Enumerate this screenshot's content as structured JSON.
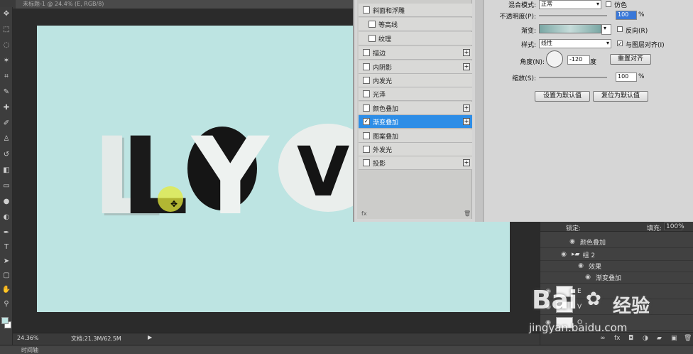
{
  "document_tab": {
    "title": "未标题-1 @ 24.4% (E, RGB/8)"
  },
  "toolbar": {
    "icons": [
      "move-icon",
      "marquee-icon",
      "lasso-icon",
      "magic-wand-icon",
      "crop-icon",
      "eyedropper-icon",
      "heal-icon",
      "brush-icon",
      "stamp-icon",
      "history-brush-icon",
      "eraser-icon",
      "gradient-icon",
      "blur-icon",
      "dodge-icon",
      "pen-icon",
      "type-icon",
      "path-select-icon",
      "shape-icon",
      "hand-icon",
      "zoom-icon"
    ]
  },
  "canvas": {
    "background": "#bde4e2",
    "letters": [
      "L",
      "Y",
      "O",
      "V"
    ]
  },
  "statusbar": {
    "zoom": "24.36%",
    "doc_size": "文档:21.3M/62.5M"
  },
  "timeline": {
    "label": "时间轴"
  },
  "layer_style": {
    "items": [
      {
        "label": "斜面和浮雕",
        "checked": false,
        "sub": false,
        "plus": false
      },
      {
        "label": "等高线",
        "checked": false,
        "sub": true,
        "plus": false
      },
      {
        "label": "纹理",
        "checked": false,
        "sub": true,
        "plus": false
      },
      {
        "label": "描边",
        "checked": false,
        "sub": false,
        "plus": true
      },
      {
        "label": "内阴影",
        "checked": false,
        "sub": false,
        "plus": true
      },
      {
        "label": "内发光",
        "checked": false,
        "sub": false,
        "plus": false
      },
      {
        "label": "光泽",
        "checked": false,
        "sub": false,
        "plus": false
      },
      {
        "label": "颜色叠加",
        "checked": false,
        "sub": false,
        "plus": true
      },
      {
        "label": "渐变叠加",
        "checked": true,
        "sub": false,
        "plus": true,
        "selected": true
      },
      {
        "label": "图案叠加",
        "checked": false,
        "sub": false,
        "plus": false
      },
      {
        "label": "外发光",
        "checked": false,
        "sub": false,
        "plus": false
      },
      {
        "label": "投影",
        "checked": false,
        "sub": false,
        "plus": true
      }
    ],
    "options": {
      "blend_mode_label": "混合模式:",
      "blend_mode_value": "正常",
      "dither_label": "仿色",
      "opacity_label": "不透明度(P):",
      "opacity_value": "100",
      "percent": "%",
      "gradient_label": "渐变:",
      "reverse_label": "反向(R)",
      "style_label": "样式:",
      "style_value": "线性",
      "align_label": "与图层对齐(I)",
      "angle_label": "角度(N):",
      "angle_value": "-120",
      "degree": "度",
      "reset_align": "重置对齐",
      "scale_label": "缩放(S):",
      "scale_value": "100",
      "set_default": "设置为默认值",
      "reset_default": "复位为默认值"
    }
  },
  "layers": {
    "lock_label": "锁定:",
    "fill_label": "填充:",
    "fill_value": "100%",
    "rows": [
      {
        "label": "颜色叠加",
        "type": "effect"
      },
      {
        "label": "组 2",
        "type": "group"
      },
      {
        "label": "效果",
        "type": "effect"
      },
      {
        "label": "渐变叠加",
        "type": "effect"
      },
      {
        "label": "E",
        "type": "layer"
      },
      {
        "label": "V",
        "type": "layer"
      },
      {
        "label": "O",
        "type": "layer"
      }
    ]
  },
  "watermark": {
    "brand": "Bai",
    "brand2": "经验",
    "url": "jingyan.baidu.com"
  }
}
